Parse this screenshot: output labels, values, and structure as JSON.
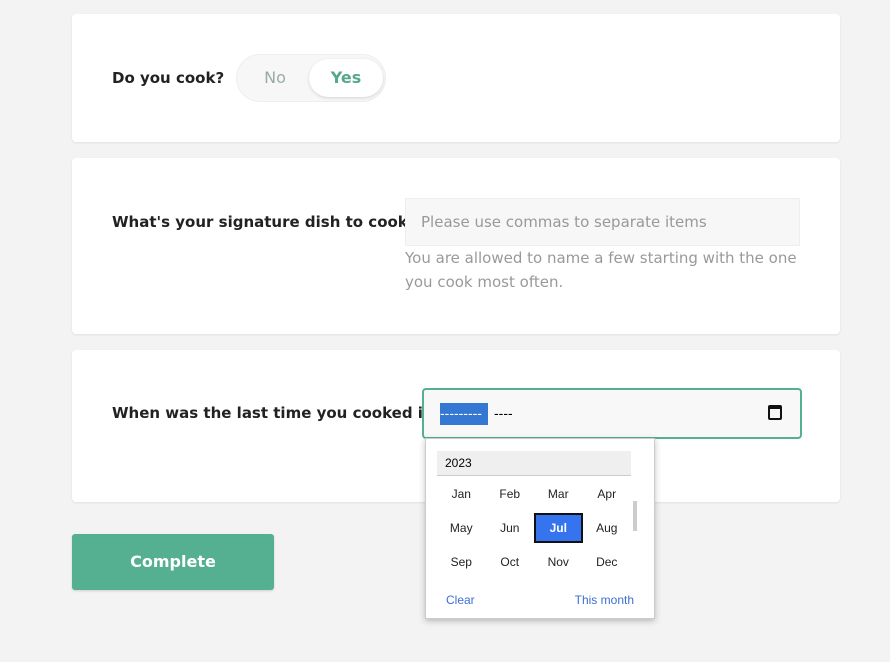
{
  "q1": {
    "label": "Do you cook?",
    "no": "No",
    "yes": "Yes",
    "selected": "Yes"
  },
  "q2": {
    "label": "What's your signature dish to cook?",
    "placeholder": "Please use commas to separate items",
    "help": "You are allowed to name a few starting with the one you cook most often."
  },
  "q3": {
    "label": "When was the last time you cooked it?",
    "month_segment": "---------",
    "year_segment": "----"
  },
  "picker": {
    "year": "2023",
    "months": [
      "Jan",
      "Feb",
      "Mar",
      "Apr",
      "May",
      "Jun",
      "Jul",
      "Aug",
      "Sep",
      "Oct",
      "Nov",
      "Dec"
    ],
    "selected": "Jul",
    "clear": "Clear",
    "this_month": "This month"
  },
  "complete": "Complete",
  "colors": {
    "accent": "#55b092",
    "picker_selected": "#3574ee"
  }
}
